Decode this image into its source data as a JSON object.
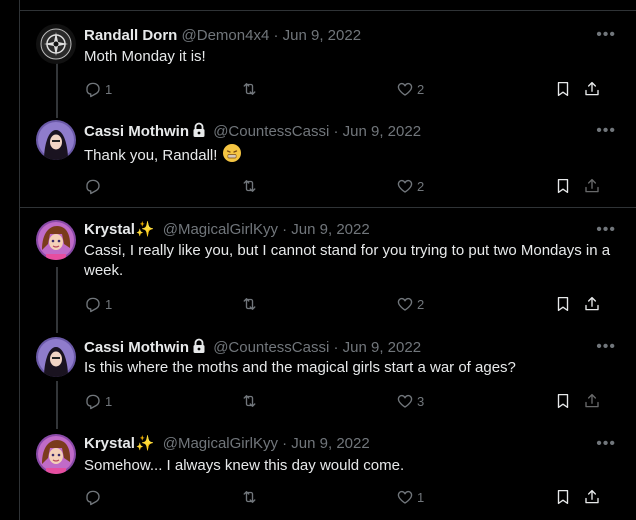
{
  "tweets": [
    {
      "name": "Randall Dorn",
      "handle": "@Demon4x4",
      "date": "· Jun 9, 2022",
      "text": "Moth Monday it is!",
      "replies": "1",
      "retweets": "",
      "likes": "2",
      "locked": false
    },
    {
      "name": "Cassi Mothwin",
      "handle": "@CountessCassi",
      "date": "· Jun 9, 2022",
      "text": "Thank you, Randall!",
      "replies": "",
      "retweets": "",
      "likes": "2",
      "locked": true
    },
    {
      "name": "Krystal",
      "name_emoji": "✨",
      "handle": "@MagicalGirlKyy",
      "date": "· Jun 9, 2022",
      "text": "Cassi, I really like you, but I cannot stand for you trying to put two Mondays in a week.",
      "replies": "1",
      "retweets": "",
      "likes": "2",
      "locked": false
    },
    {
      "name": "Cassi Mothwin",
      "handle": "@CountessCassi",
      "date": "· Jun 9, 2022",
      "text": "Is this where the moths and the magical girls start a war of ages?",
      "replies": "1",
      "retweets": "",
      "likes": "3",
      "locked": true
    },
    {
      "name": "Krystal",
      "name_emoji": "✨",
      "handle": "@MagicalGirlKyy",
      "date": "· Jun 9, 2022",
      "text": "Somehow... I always knew this day would come.",
      "replies": "",
      "retweets": "",
      "likes": "1",
      "locked": false
    }
  ],
  "colors": {
    "background": "#000000",
    "text": "#e7e9ea",
    "muted": "#71767b",
    "divider": "#2f3336",
    "sparkle": "#f7c948"
  },
  "icons": [
    "more-icon",
    "reply-icon",
    "retweet-icon",
    "like-icon",
    "bookmark-icon",
    "share-icon",
    "lock-icon",
    "sparkles-icon",
    "emoji-face-icon"
  ]
}
